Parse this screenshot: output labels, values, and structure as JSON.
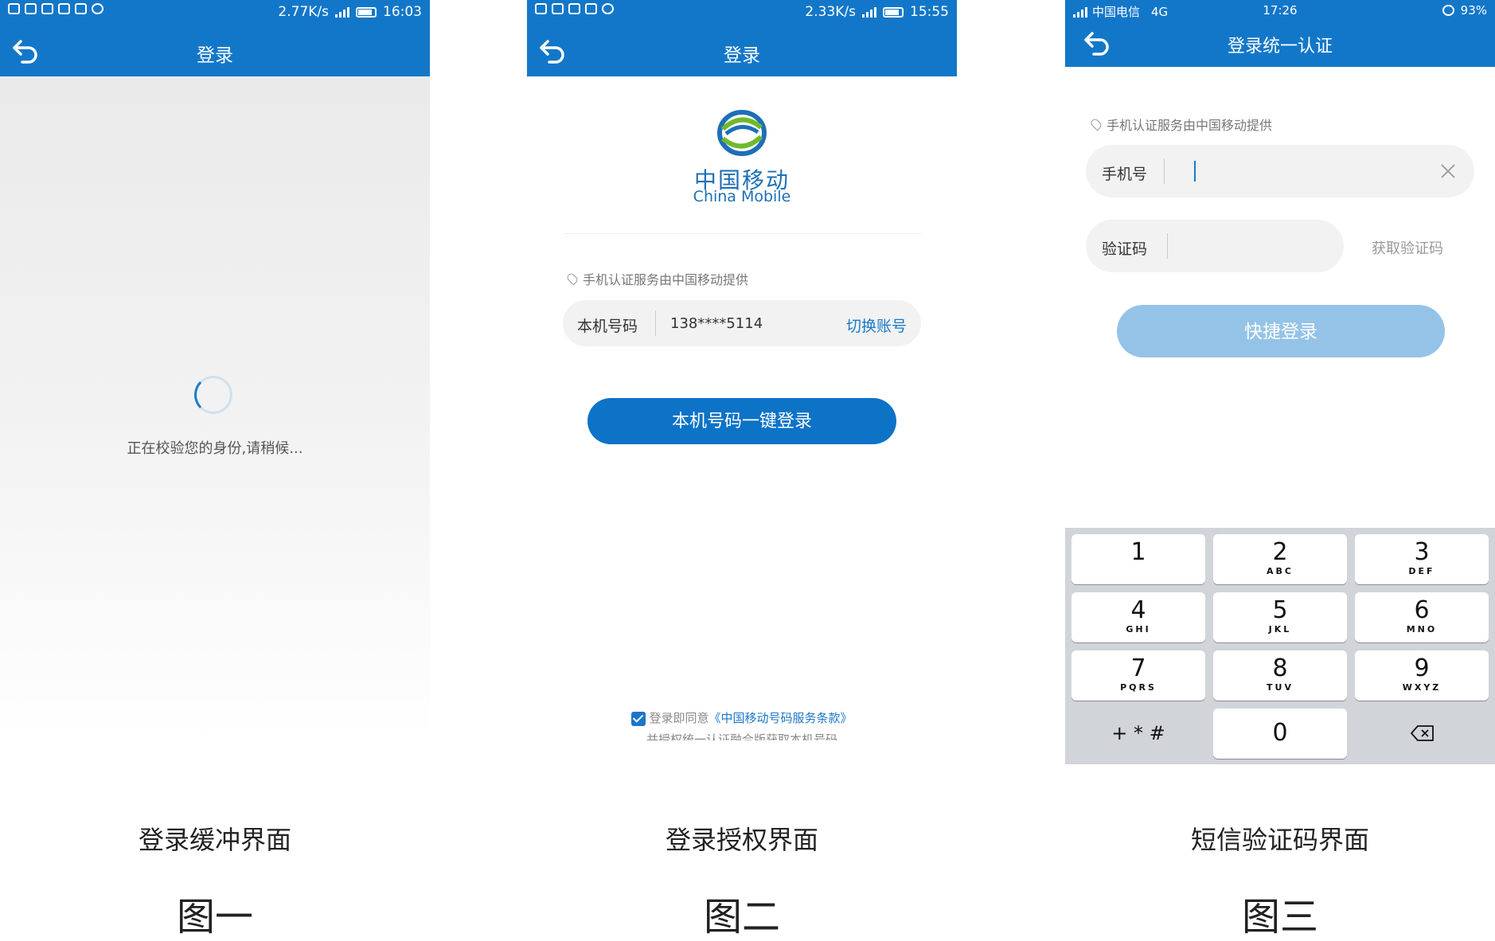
{
  "phone1": {
    "status": {
      "speed": "2.77K/s",
      "time": "16:03"
    },
    "appbar": {
      "title": "登录"
    },
    "message": "正在校验您的身份,请稍候...",
    "caption": "登录缓冲界面",
    "figure_label": "图一"
  },
  "phone2": {
    "status": {
      "speed": "2.33K/s",
      "time": "15:55"
    },
    "appbar": {
      "title": "登录"
    },
    "brand_cn": "中国移动",
    "brand_en": "China Mobile",
    "provider_text": "手机认证服务由中国移动提供",
    "phone_row": {
      "label": "本机号码",
      "number": "138****5114",
      "switch_label": "切换账号"
    },
    "login_button": "本机号码一键登录",
    "agreement": {
      "prefix": "登录即同意",
      "link": "《中国移动号码服务条款》",
      "line2": "并授权统一认证融合版获取本机号码"
    },
    "caption": "登录授权界面",
    "figure_label": "图二"
  },
  "phone3": {
    "status": {
      "carrier": "中国电信",
      "network": "4G",
      "time": "17:26",
      "battery": "93%"
    },
    "appbar": {
      "title": "登录统一认证"
    },
    "provider_text": "手机认证服务由中国移动提供",
    "phone_field": {
      "label": "手机号",
      "value": ""
    },
    "code_field": {
      "label": "验证码",
      "value": ""
    },
    "get_code": "获取验证码",
    "quick_login": "快捷登录",
    "keypad": [
      {
        "digit": "1",
        "letters": ""
      },
      {
        "digit": "2",
        "letters": "ABC"
      },
      {
        "digit": "3",
        "letters": "DEF"
      },
      {
        "digit": "4",
        "letters": "GHI"
      },
      {
        "digit": "5",
        "letters": "JKL"
      },
      {
        "digit": "6",
        "letters": "MNO"
      },
      {
        "digit": "7",
        "letters": "PQRS"
      },
      {
        "digit": "8",
        "letters": "TUV"
      },
      {
        "digit": "9",
        "letters": "WXYZ"
      },
      {
        "digit": "+ * #",
        "letters": ""
      },
      {
        "digit": "0",
        "letters": ""
      }
    ],
    "caption": "短信验证码界面",
    "figure_label": "图三"
  },
  "colors": {
    "brand_blue": "#1377c9",
    "button_blue": "#0c73c7",
    "disabled_blue": "#95c3e8"
  },
  "icons": [
    "back-arrow-icon",
    "spinner-icon",
    "china-mobile-logo",
    "location-pin-icon",
    "checkbox-icon",
    "clear-icon",
    "backspace-icon"
  ]
}
